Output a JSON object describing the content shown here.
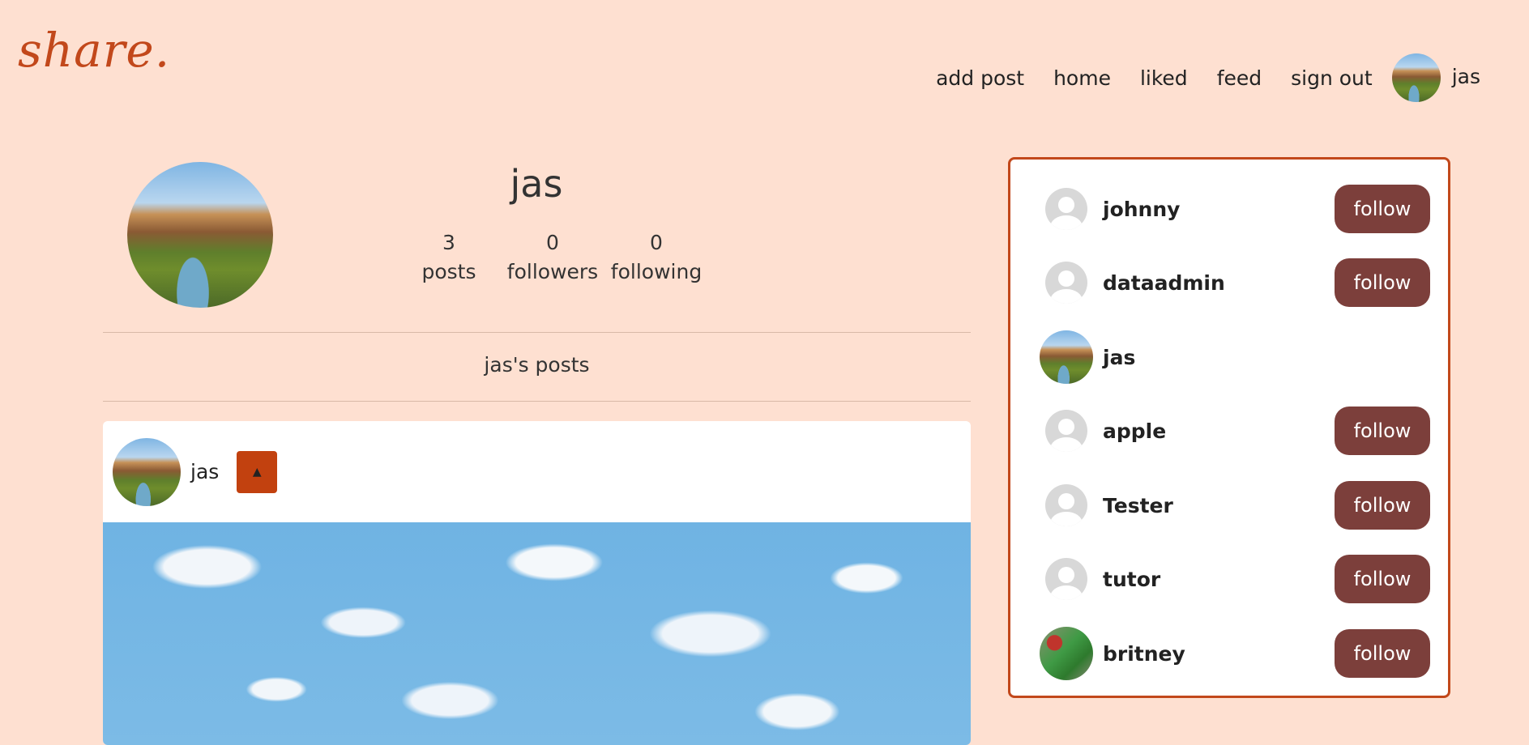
{
  "brand": {
    "logo": "share."
  },
  "nav": {
    "items": [
      "add post",
      "home",
      "liked",
      "feed",
      "sign out"
    ],
    "user_name": "jas"
  },
  "profile": {
    "name": "jas",
    "stats": [
      {
        "value": "3",
        "label": "posts"
      },
      {
        "value": "0",
        "label": "followers"
      },
      {
        "value": "0",
        "label": "following"
      }
    ],
    "posts_heading": "jas's posts"
  },
  "post": {
    "author": "jas",
    "menu_icon": "caret-up-icon",
    "image": "sky-clouds-photo"
  },
  "users_panel": {
    "follow_label": "follow",
    "users": [
      {
        "name": "johnny",
        "avatar": "default-avatar",
        "can_follow": true
      },
      {
        "name": "dataadmin",
        "avatar": "default-avatar",
        "can_follow": true
      },
      {
        "name": "jas",
        "avatar": "landscape-avatar",
        "can_follow": false
      },
      {
        "name": "apple",
        "avatar": "default-avatar",
        "can_follow": true
      },
      {
        "name": "Tester",
        "avatar": "default-avatar",
        "can_follow": true
      },
      {
        "name": "tutor",
        "avatar": "default-avatar",
        "can_follow": true
      },
      {
        "name": "britney",
        "avatar": "photo-avatar",
        "can_follow": true
      }
    ]
  },
  "colors": {
    "background": "#fee0d1",
    "accent": "#c2481b",
    "follow_button": "#7c3f3b"
  }
}
